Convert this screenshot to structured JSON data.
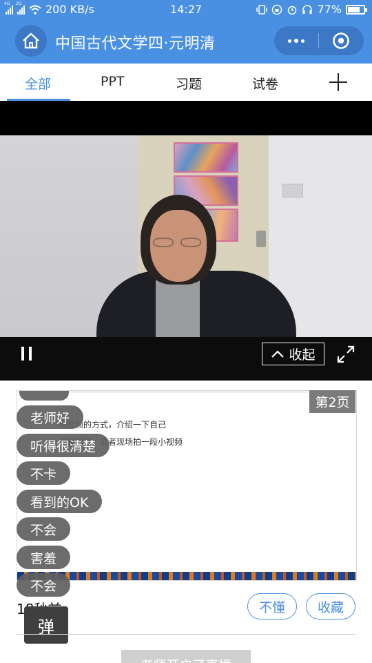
{
  "status_bar": {
    "network_left": "4G",
    "network_right": "2G",
    "speed": "200 KB/s",
    "time": "14:27",
    "battery": "77%",
    "battery_level": 0.77
  },
  "header": {
    "title": "中国古代文学四·元明清"
  },
  "tabs": [
    {
      "label": "全部",
      "active": true
    },
    {
      "label": "PPT",
      "active": false
    },
    {
      "label": "习题",
      "active": false
    },
    {
      "label": "试卷",
      "active": false
    }
  ],
  "video": {
    "collapse_label": "收起"
  },
  "slide": {
    "page_badge": "第2页",
    "line1": "用视频的方式，介绍一下自己",
    "line2": "录制视频，或者现场拍一段小视频"
  },
  "danmaku": [
    "老师好",
    "听得很清楚",
    "不卡",
    "看到的OK",
    "不会",
    "害羞",
    "不会"
  ],
  "time_ago": "18秒前",
  "danmaku_button": "弹",
  "actions": {
    "dont_understand": "不懂",
    "favorite": "收藏"
  },
  "bottom_button": "老师开启了直播",
  "colors": {
    "brand_blue": "#4a90e2",
    "danmaku_bg": "#5f5f5f"
  }
}
